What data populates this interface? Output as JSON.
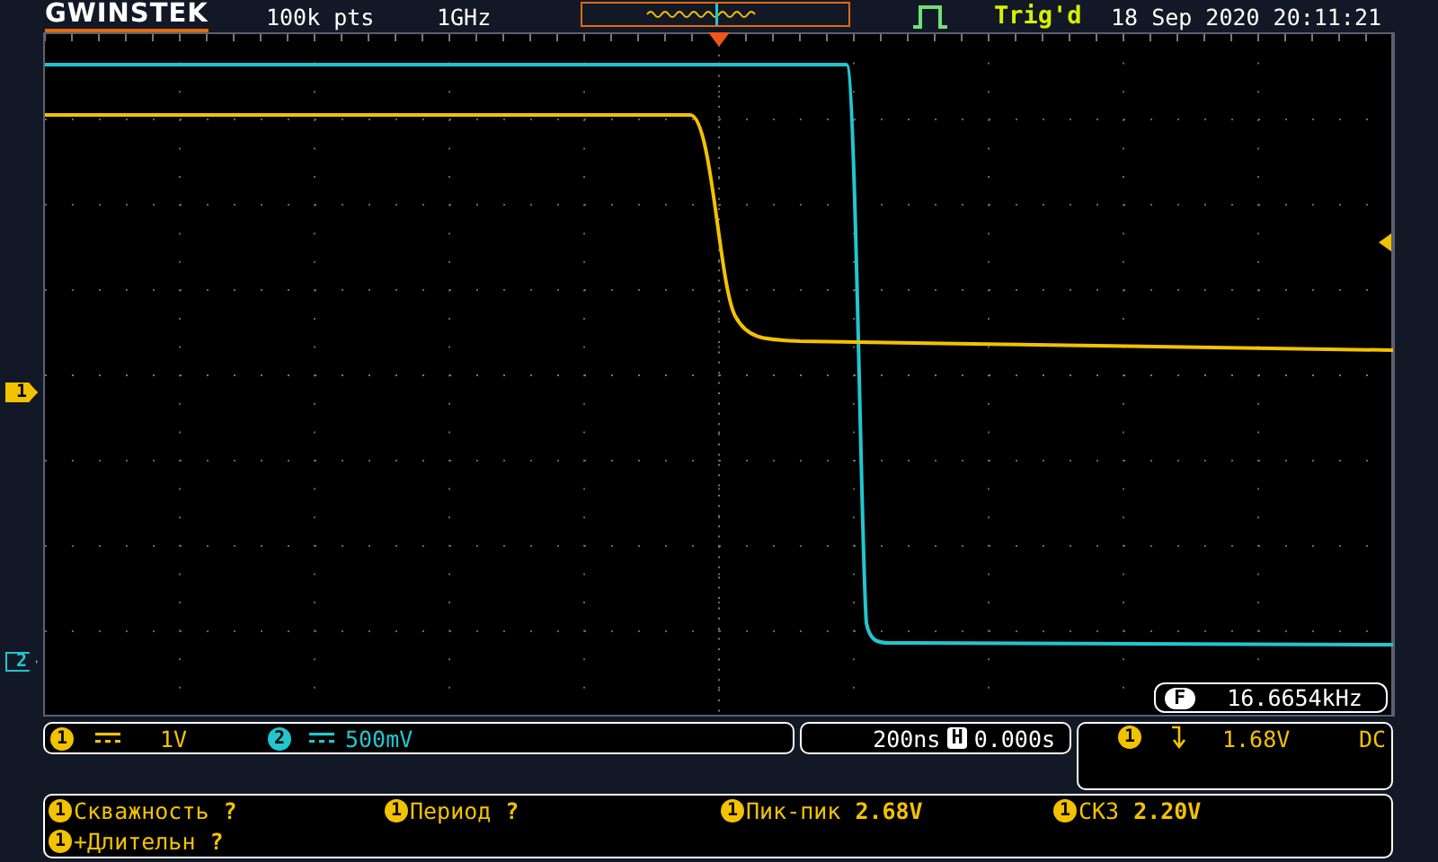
{
  "header": {
    "logo": "GWINSTEK",
    "memory": "100k pts",
    "bandwidth": "1GHz",
    "trigger_status": "Trig'd",
    "datetime": "18 Sep 2020 20:11:21"
  },
  "channel_markers": [
    {
      "label": "1",
      "active": true
    },
    {
      "label": "2",
      "active": false
    }
  ],
  "frequency": {
    "label": "F",
    "value": "16.6654kHz"
  },
  "channels": [
    {
      "number": "1",
      "color": "#f2c200",
      "scale": "1V"
    },
    {
      "number": "2",
      "color": "#22c6cf",
      "scale": "500mV"
    }
  ],
  "timebase": {
    "scale": "200ns",
    "label": "H",
    "position": "0.000s"
  },
  "trigger": {
    "source": "1",
    "level": "1.68V",
    "coupling": "DC"
  },
  "measurements": [
    {
      "source": "1",
      "name": "Скважность",
      "value": "?"
    },
    {
      "source": "1",
      "name": "Период",
      "value": "?"
    },
    {
      "source": "1",
      "name": "Пик-пик",
      "value": "2.68V"
    },
    {
      "source": "1",
      "name": "СКЗ",
      "value": "2.20V"
    },
    {
      "source": "1",
      "name": "+Длительн",
      "value": "?"
    }
  ]
}
